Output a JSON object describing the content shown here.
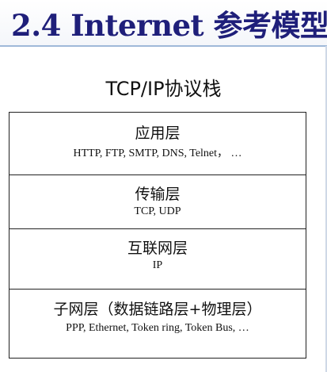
{
  "header": {
    "title": "2.4 Internet 参考模型"
  },
  "stack": {
    "title": "TCP/IP协议栈",
    "layers": [
      {
        "name": "应用层",
        "protocols": "HTTP, FTP, SMTP, DNS, Telnet， …"
      },
      {
        "name": "传输层",
        "protocols": "TCP, UDP"
      },
      {
        "name": "互联网层",
        "protocols": "IP"
      },
      {
        "name": "子网层（数据链路层+物理层）",
        "protocols": "PPP, Ethernet, Token ring, Token Bus, …"
      }
    ]
  },
  "colors": {
    "title": "#1f1f7a",
    "divider": "#9fb9d9",
    "border": "#222222"
  }
}
